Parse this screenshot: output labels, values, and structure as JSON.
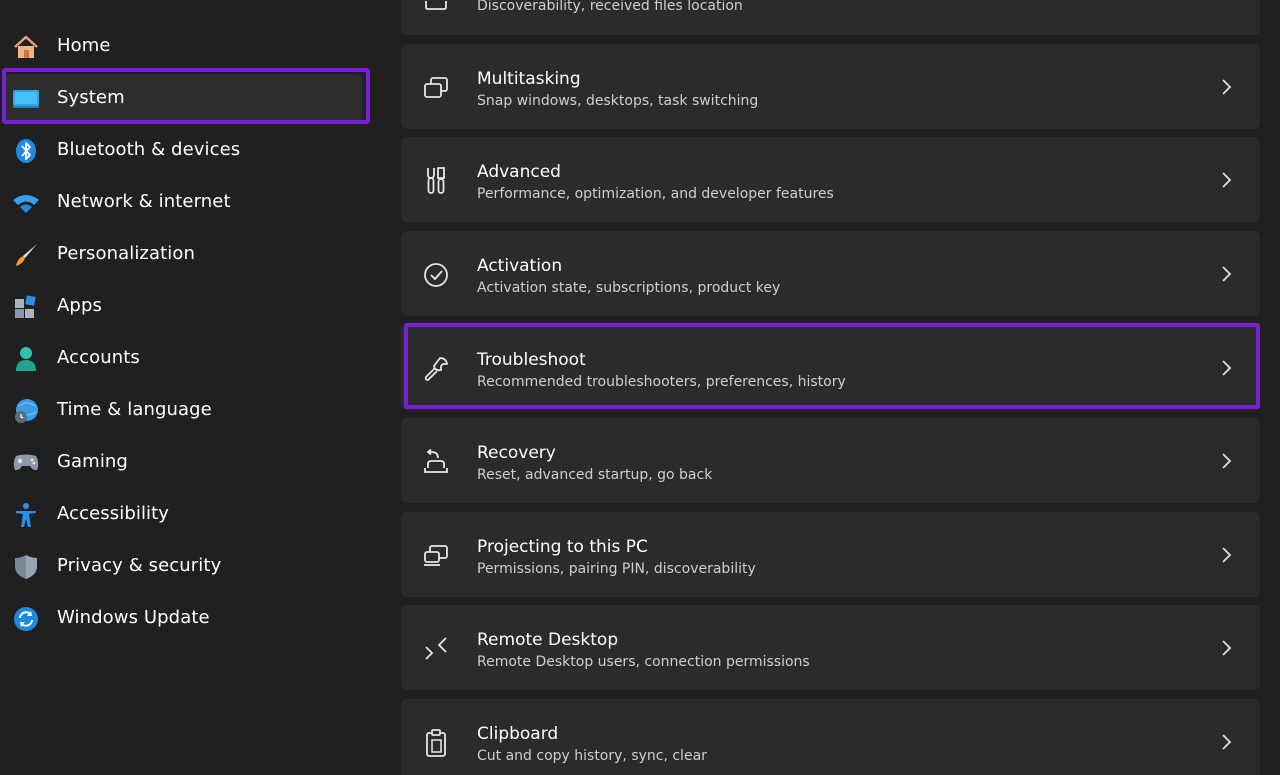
{
  "sidebar": {
    "items": [
      {
        "label": "Home",
        "icon": "home-icon"
      },
      {
        "label": "System",
        "icon": "system-icon",
        "selected": true
      },
      {
        "label": "Bluetooth & devices",
        "icon": "bluetooth-icon"
      },
      {
        "label": "Network & internet",
        "icon": "wifi-icon"
      },
      {
        "label": "Personalization",
        "icon": "paintbrush-icon"
      },
      {
        "label": "Apps",
        "icon": "apps-icon"
      },
      {
        "label": "Accounts",
        "icon": "person-icon"
      },
      {
        "label": "Time & language",
        "icon": "globe-clock-icon"
      },
      {
        "label": "Gaming",
        "icon": "gamepad-icon"
      },
      {
        "label": "Accessibility",
        "icon": "accessibility-icon"
      },
      {
        "label": "Privacy & security",
        "icon": "shield-icon"
      },
      {
        "label": "Windows Update",
        "icon": "update-icon"
      }
    ]
  },
  "main": {
    "cards": [
      {
        "title": "",
        "subtitle": "Discoverability, received files location",
        "icon": "nearby-sharing-icon"
      },
      {
        "title": "Multitasking",
        "subtitle": "Snap windows, desktops, task switching",
        "icon": "multitasking-icon"
      },
      {
        "title": "Advanced",
        "subtitle": "Performance, optimization, and developer features",
        "icon": "tools-icon"
      },
      {
        "title": "Activation",
        "subtitle": "Activation state, subscriptions, product key",
        "icon": "check-circle-icon"
      },
      {
        "title": "Troubleshoot",
        "subtitle": "Recommended troubleshooters, preferences, history",
        "icon": "wrench-icon",
        "highlighted": true
      },
      {
        "title": "Recovery",
        "subtitle": "Reset, advanced startup, go back",
        "icon": "recovery-icon"
      },
      {
        "title": "Projecting to this PC",
        "subtitle": "Permissions, pairing PIN, discoverability",
        "icon": "projecting-icon"
      },
      {
        "title": "Remote Desktop",
        "subtitle": "Remote Desktop users, connection permissions",
        "icon": "remote-desktop-icon"
      },
      {
        "title": "Clipboard",
        "subtitle": "Cut and copy history, sync, clear",
        "icon": "clipboard-icon"
      }
    ]
  },
  "colors": {
    "highlight": "#7a1fd6",
    "background": "#202020",
    "card": "#2b2b2b",
    "accent": "#0a84d6"
  }
}
